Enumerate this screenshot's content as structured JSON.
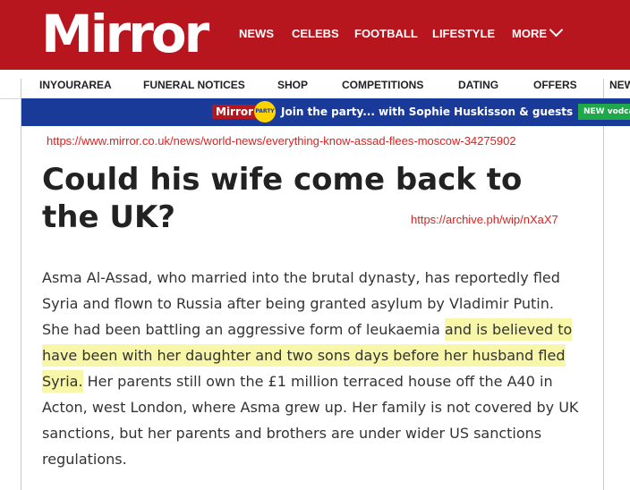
{
  "header": {
    "logo": "Mirror",
    "nav": [
      "NEWS",
      "CELEBS",
      "FOOTBALL",
      "LIFESTYLE",
      "MORE"
    ]
  },
  "subnav": [
    "INYOURAREA",
    "FUNERAL NOTICES",
    "SHOP",
    "COMPETITIONS",
    "DATING",
    "OFFERS",
    "NEW"
  ],
  "promo": {
    "logo": "Mirror",
    "party_badge": "PARTY",
    "text": "Join the party... with Sophie Huskisson & guests",
    "badge": "NEW vodcast"
  },
  "annotations": {
    "source_url": "https://www.mirror.co.uk/news/world-news/everything-know-assad-flees-moscow-34275902",
    "archive_url": "https://archive.ph/wip/nXaX7"
  },
  "article": {
    "headline": "Could his wife come back to the UK?",
    "paragraph_start": "Asma Al-Assad, who married into the brutal dynasty, has reportedly fled Syria and flown to Russia after being granted asylum by Vladimir Putin. She had been battling an aggressive form of leukaemia ",
    "paragraph_highlight": "and is believed to have been with her daughter and two sons days before her husband fled Syria.",
    "paragraph_end": " Her parents still own the £1 million terraced house off the A40 in Acton, west London, where Asma grew up. Her family is not covered by UK sanctions, but her parents and brothers are under wider US sanctions regulations."
  },
  "colors": {
    "brand_red": "#b8161e",
    "annotation_red": "#e0201e",
    "highlight": "#f8f6a8"
  }
}
